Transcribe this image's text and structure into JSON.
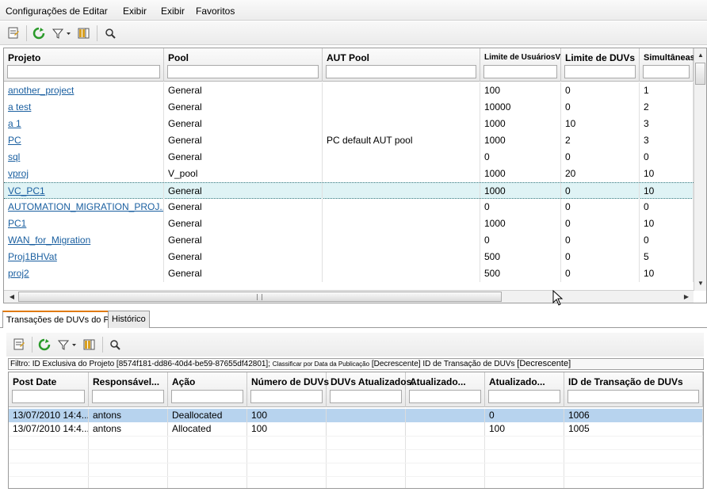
{
  "menu": [
    {
      "label": "Configurações de Editar"
    },
    {
      "label": "Exibir"
    },
    {
      "label": "Exibir"
    },
    {
      "label": "Favoritos"
    }
  ],
  "projects_grid": {
    "columns": [
      {
        "label": "Projeto"
      },
      {
        "label": "Pool"
      },
      {
        "label": "AUT Pool"
      },
      {
        "label": "Limite de UsuáriosV"
      },
      {
        "label": "Limite de DUVs"
      },
      {
        "label": "Simultâneas"
      }
    ],
    "rows": [
      {
        "projeto": "another_project",
        "pool": "General",
        "aut_pool": "",
        "limite_usuarios": "100",
        "limite_duvs": "0",
        "simultaneas": "1"
      },
      {
        "projeto": "a test",
        "pool": "General",
        "aut_pool": "",
        "limite_usuarios": "10000",
        "limite_duvs": "0",
        "simultaneas": "2"
      },
      {
        "projeto": "a 1",
        "pool": "General",
        "aut_pool": "",
        "limite_usuarios": "1000",
        "limite_duvs": "10",
        "simultaneas": "3"
      },
      {
        "projeto": "PC",
        "pool": "General",
        "aut_pool": "PC default AUT pool",
        "limite_usuarios": "1000",
        "limite_duvs": "2",
        "simultaneas": "3"
      },
      {
        "projeto": "sql",
        "pool": "General",
        "aut_pool": "",
        "limite_usuarios": "0",
        "limite_duvs": "0",
        "simultaneas": "0"
      },
      {
        "projeto": "vproj",
        "pool": "V_pool",
        "aut_pool": "",
        "limite_usuarios": "1000",
        "limite_duvs": "20",
        "simultaneas": "10"
      },
      {
        "projeto": "VC_PC1",
        "pool": "General",
        "aut_pool": "",
        "limite_usuarios": "1000",
        "limite_duvs": "0",
        "simultaneas": "10"
      },
      {
        "projeto": "AUTOMATION_MIGRATION_PROJ...",
        "pool": "General",
        "aut_pool": "",
        "limite_usuarios": "0",
        "limite_duvs": "0",
        "simultaneas": "0"
      },
      {
        "projeto": "PC1",
        "pool": "General",
        "aut_pool": "",
        "limite_usuarios": "1000",
        "limite_duvs": "0",
        "simultaneas": "10"
      },
      {
        "projeto": "WAN_for_Migration",
        "pool": "General",
        "aut_pool": "",
        "limite_usuarios": "0",
        "limite_duvs": "0",
        "simultaneas": "0"
      },
      {
        "projeto": "Proj1BHVat",
        "pool": "General",
        "aut_pool": "",
        "limite_usuarios": "500",
        "limite_duvs": "0",
        "simultaneas": "5"
      },
      {
        "projeto": "proj2",
        "pool": "General",
        "aut_pool": "",
        "limite_usuarios": "500",
        "limite_duvs": "0",
        "simultaneas": "10"
      }
    ]
  },
  "tabs": [
    {
      "label": "Transações de DUVs do PC"
    },
    {
      "label": "Histórico"
    }
  ],
  "filter": {
    "part1": "Filtro: ID Exclusiva do Projeto [8574f181-dd86-40d4-be59-87655df42801];",
    "part2": "Classificar por Data da Publicação",
    "part3": "[Decrescente]",
    "part4": "ID de Transação de DUVs",
    "part5": "[Decrescente]"
  },
  "transactions_grid": {
    "columns": [
      {
        "label": "Post Date"
      },
      {
        "label": "Responsável..."
      },
      {
        "label": "Ação"
      },
      {
        "label": "Número de DUVs"
      },
      {
        "label": "DUVs Atualizados..."
      },
      {
        "label": "Atualizado..."
      },
      {
        "label": "Atualizado..."
      },
      {
        "label": "ID de Transação de DUVs"
      }
    ],
    "rows": [
      {
        "post_date": "13/07/2010  14:4...",
        "responsavel": "antons",
        "acao": "Deallocated",
        "numero_duvs": "100",
        "duvs_atualizados": "",
        "atualizado1": "",
        "atualizado2": "0",
        "id_transacao": "1006"
      },
      {
        "post_date": "13/07/2010  14:4...",
        "responsavel": "antons",
        "acao": "Allocated",
        "numero_duvs": "100",
        "duvs_atualizados": "",
        "atualizado1": "",
        "atualizado2": "100",
        "id_transacao": "1005"
      }
    ]
  },
  "colors": {
    "link": "#1a5fa0",
    "selected_row_top": "#dff3f5",
    "selected_row_bottom": "#b7d3ee",
    "active_tab_accent": "#e07a10"
  },
  "icons": [
    "notes-icon",
    "refresh-icon",
    "filter-icon",
    "columns-icon",
    "search-icon"
  ]
}
